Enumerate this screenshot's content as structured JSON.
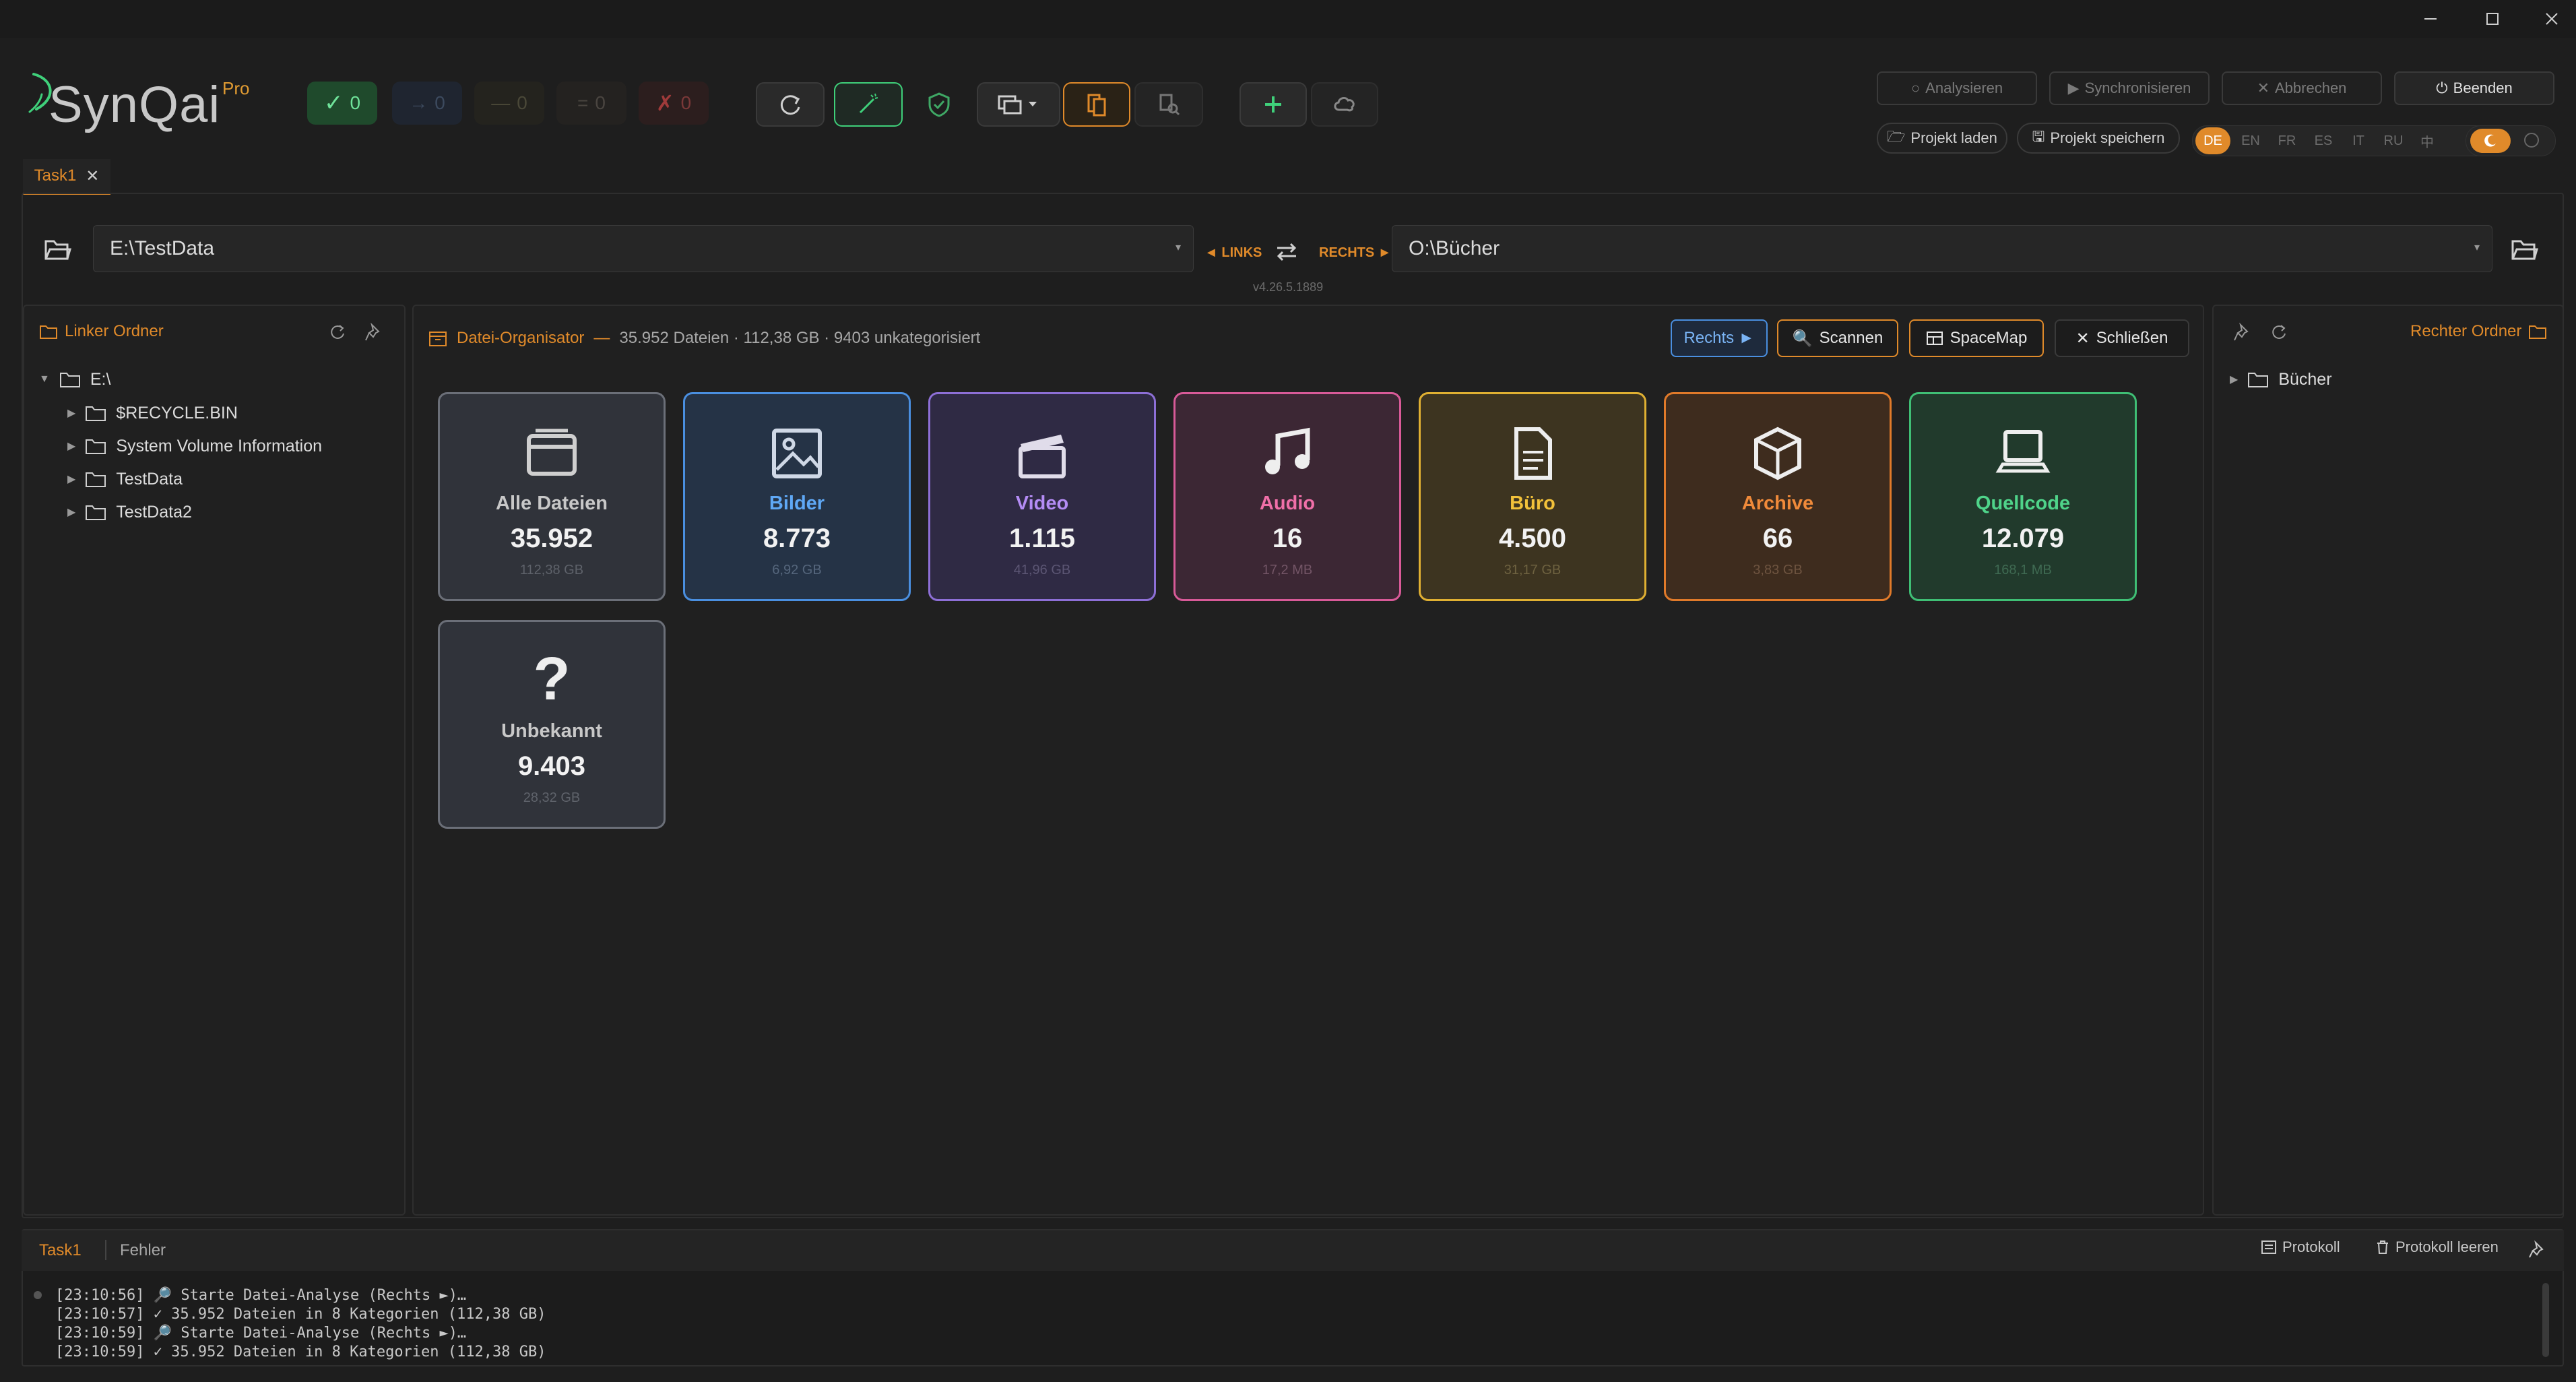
{
  "window": {
    "minimize": "—",
    "maximize": "☐",
    "close": "✕"
  },
  "app": {
    "name": "SynQai",
    "edition": "Pro"
  },
  "status": {
    "ok": "0",
    "arrow_right": "0",
    "dash": "0",
    "equal": "0",
    "error": "0"
  },
  "actions": {
    "analyze": "Analysieren",
    "sync": "Synchronisieren",
    "cancel": "Abbrechen",
    "quit": "Beenden",
    "load_project": "Projekt laden",
    "save_project": "Projekt speichern"
  },
  "languages": [
    "DE",
    "EN",
    "FR",
    "ES",
    "IT",
    "RU",
    "中"
  ],
  "selected_language": "DE",
  "tab": {
    "label": "Task1"
  },
  "paths": {
    "left": "E:\\TestData",
    "right": "O:\\Bücher",
    "left_label": "◄ LINKS",
    "right_label": "RECHTS ►",
    "version": "v4.26.5.1889"
  },
  "left_panel": {
    "title": "Linker Ordner",
    "root": "E:\\",
    "items": [
      "$RECYCLE.BIN",
      "System Volume Information",
      "TestData",
      "TestData2"
    ]
  },
  "right_panel": {
    "title": "Rechter Ordner",
    "items": [
      "Bücher"
    ]
  },
  "organizer": {
    "title": "Datei-Organisator",
    "separator": "—",
    "summary": "35.952 Dateien · 112,38 GB · 9403 unkategorisiert",
    "side_button": "Rechts ►",
    "scan_button": "Scannen",
    "spacemap_button": "SpaceMap",
    "close_button": "Schließen",
    "categories": [
      {
        "name": "Alle Dateien",
        "count": "35.952",
        "size": "112,38 GB",
        "color": "#c8c8c8",
        "icon": "folder-files-icon"
      },
      {
        "name": "Bilder",
        "count": "8.773",
        "size": "6,92 GB",
        "color": "#5fa8f5",
        "icon": "image-icon"
      },
      {
        "name": "Video",
        "count": "1.115",
        "size": "41,96 GB",
        "color": "#b48cf5",
        "icon": "clapperboard-icon"
      },
      {
        "name": "Audio",
        "count": "16",
        "size": "17,2 MB",
        "color": "#f06fa8",
        "icon": "music-note-icon"
      },
      {
        "name": "Büro",
        "count": "4.500",
        "size": "31,17 GB",
        "color": "#f2c13a",
        "icon": "document-icon"
      },
      {
        "name": "Archive",
        "count": "66",
        "size": "3,83 GB",
        "color": "#f08a3a",
        "icon": "box-icon"
      },
      {
        "name": "Quellcode",
        "count": "12.079",
        "size": "168,1 MB",
        "color": "#4fd48a",
        "icon": "laptop-icon"
      },
      {
        "name": "Unbekannt",
        "count": "9.403",
        "size": "28,32 GB",
        "color": "#c8c8c8",
        "icon": "question-icon"
      }
    ]
  },
  "log": {
    "tabs": [
      "Task1",
      "Fehler"
    ],
    "protocol_button": "Protokoll",
    "clear_button": "Protokoll leeren",
    "lines": [
      "[23:10:56] 🔎 Starte Datei-Analyse (Rechts ►)…",
      "[23:10:57] ✓ 35.952 Dateien in 8 Kategorien (112,38 GB)",
      "[23:10:59] 🔎 Starte Datei-Analyse (Rechts ►)…",
      "[23:10:59] ✓ 35.952 Dateien in 8 Kategorien (112,38 GB)"
    ]
  },
  "colors": {
    "accent": "#e08a2a",
    "background": "#1e1e1e",
    "panel": "#202020"
  }
}
